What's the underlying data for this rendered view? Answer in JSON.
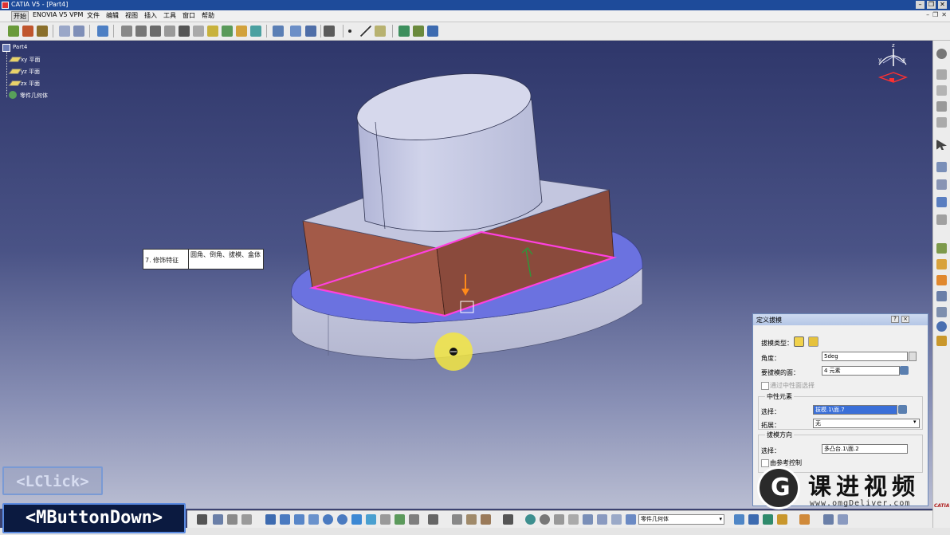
{
  "window": {
    "title": "CATIA V5 - [Part4]",
    "controls": [
      "–",
      "❐",
      "✕"
    ]
  },
  "menubar": {
    "items": [
      "开始",
      "ENOVIA V5 VPM",
      "文件",
      "编辑",
      "视图",
      "插入",
      "工具",
      "窗口",
      "帮助"
    ],
    "doc_controls": [
      "–",
      "❐",
      "✕"
    ]
  },
  "spec_tree": {
    "root": "Part4",
    "items": [
      "xy 平面",
      "yz 平面",
      "zx 平面",
      "零件几何体"
    ]
  },
  "tooltip": {
    "step": "7. 修饰特征",
    "description": "圆角、倒角、拔模、盒体"
  },
  "dialog": {
    "title": "定义拔模",
    "draft_type_label": "拔模类型：",
    "angle_label": "角度：",
    "angle_value": "5deg",
    "faces_label": "要拔模的面：",
    "faces_value": "4 元素",
    "neutral_select_checkbox": "通过中性面选择",
    "neutral_group": "中性元素",
    "neutral_select_label": "选择：",
    "neutral_select_value": "拔模.1\\面.7",
    "propagation_label": "拓展：",
    "propagation_value": "无",
    "pull_group": "拔模方向",
    "pull_select_label": "选择：",
    "pull_select_value": "多凸台.1\\面.2",
    "controlled_checkbox": "由参考控制"
  },
  "bottom_toolbar": {
    "current_body": "零件几何体"
  },
  "key_hints": {
    "lclick": "<LClick>",
    "mbutton": "<MButtonDown>"
  },
  "watermark": {
    "brand": "课进视频",
    "url": "www.omgDeliver.com",
    "logo_letter": "G"
  },
  "catia_logo": "CATIA",
  "colors": {
    "draft_face": "#a35a48",
    "neutral_plane": "#ff40e0",
    "base_disc_top": "#6b72e0",
    "part_gray": "#c9cbe0",
    "dialog_border": "#6d89b8",
    "selected_field": "#3a6fd8"
  },
  "icons": {
    "tree_root": "part-icon",
    "planes": "plane-icon",
    "body": "gear-icon",
    "compass": "compass-icon",
    "pull_direction": "arrow-down-icon"
  }
}
